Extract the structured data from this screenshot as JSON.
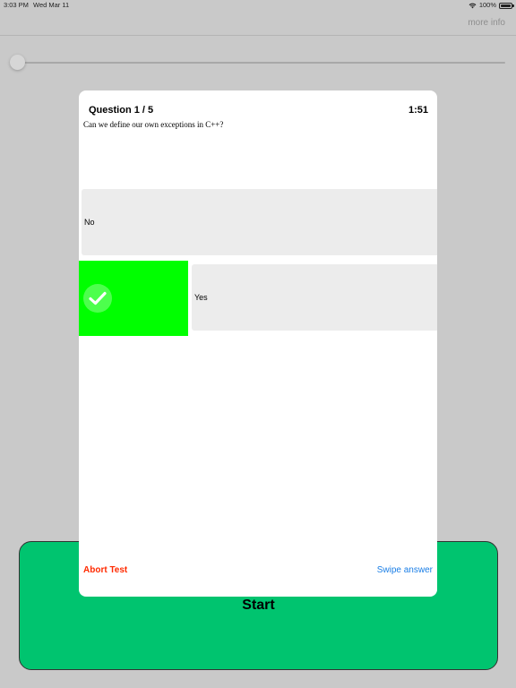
{
  "status_bar": {
    "time": "3:03 PM",
    "date": "Wed Mar 11",
    "battery": "100%"
  },
  "nav": {
    "more_info": "more info"
  },
  "slider": {
    "value": 0
  },
  "start_button": {
    "label": "Start"
  },
  "quiz": {
    "title": "Question 1 / 5",
    "timer": "1:51",
    "question": "Can we define our own exceptions in C++?",
    "answers": [
      {
        "label": "No"
      },
      {
        "label": "Yes",
        "swiped": true
      }
    ],
    "abort_label": "Abort Test",
    "swipe_label": "Swipe answer"
  },
  "colors": {
    "accent_green": "#00c46f",
    "swipe_green": "#00ff00",
    "abort_red": "#ff2a00",
    "link_blue": "#1a7ee6"
  },
  "icons": {
    "wifi": "wifi-icon",
    "battery": "battery-icon",
    "check": "checkmark-icon"
  }
}
